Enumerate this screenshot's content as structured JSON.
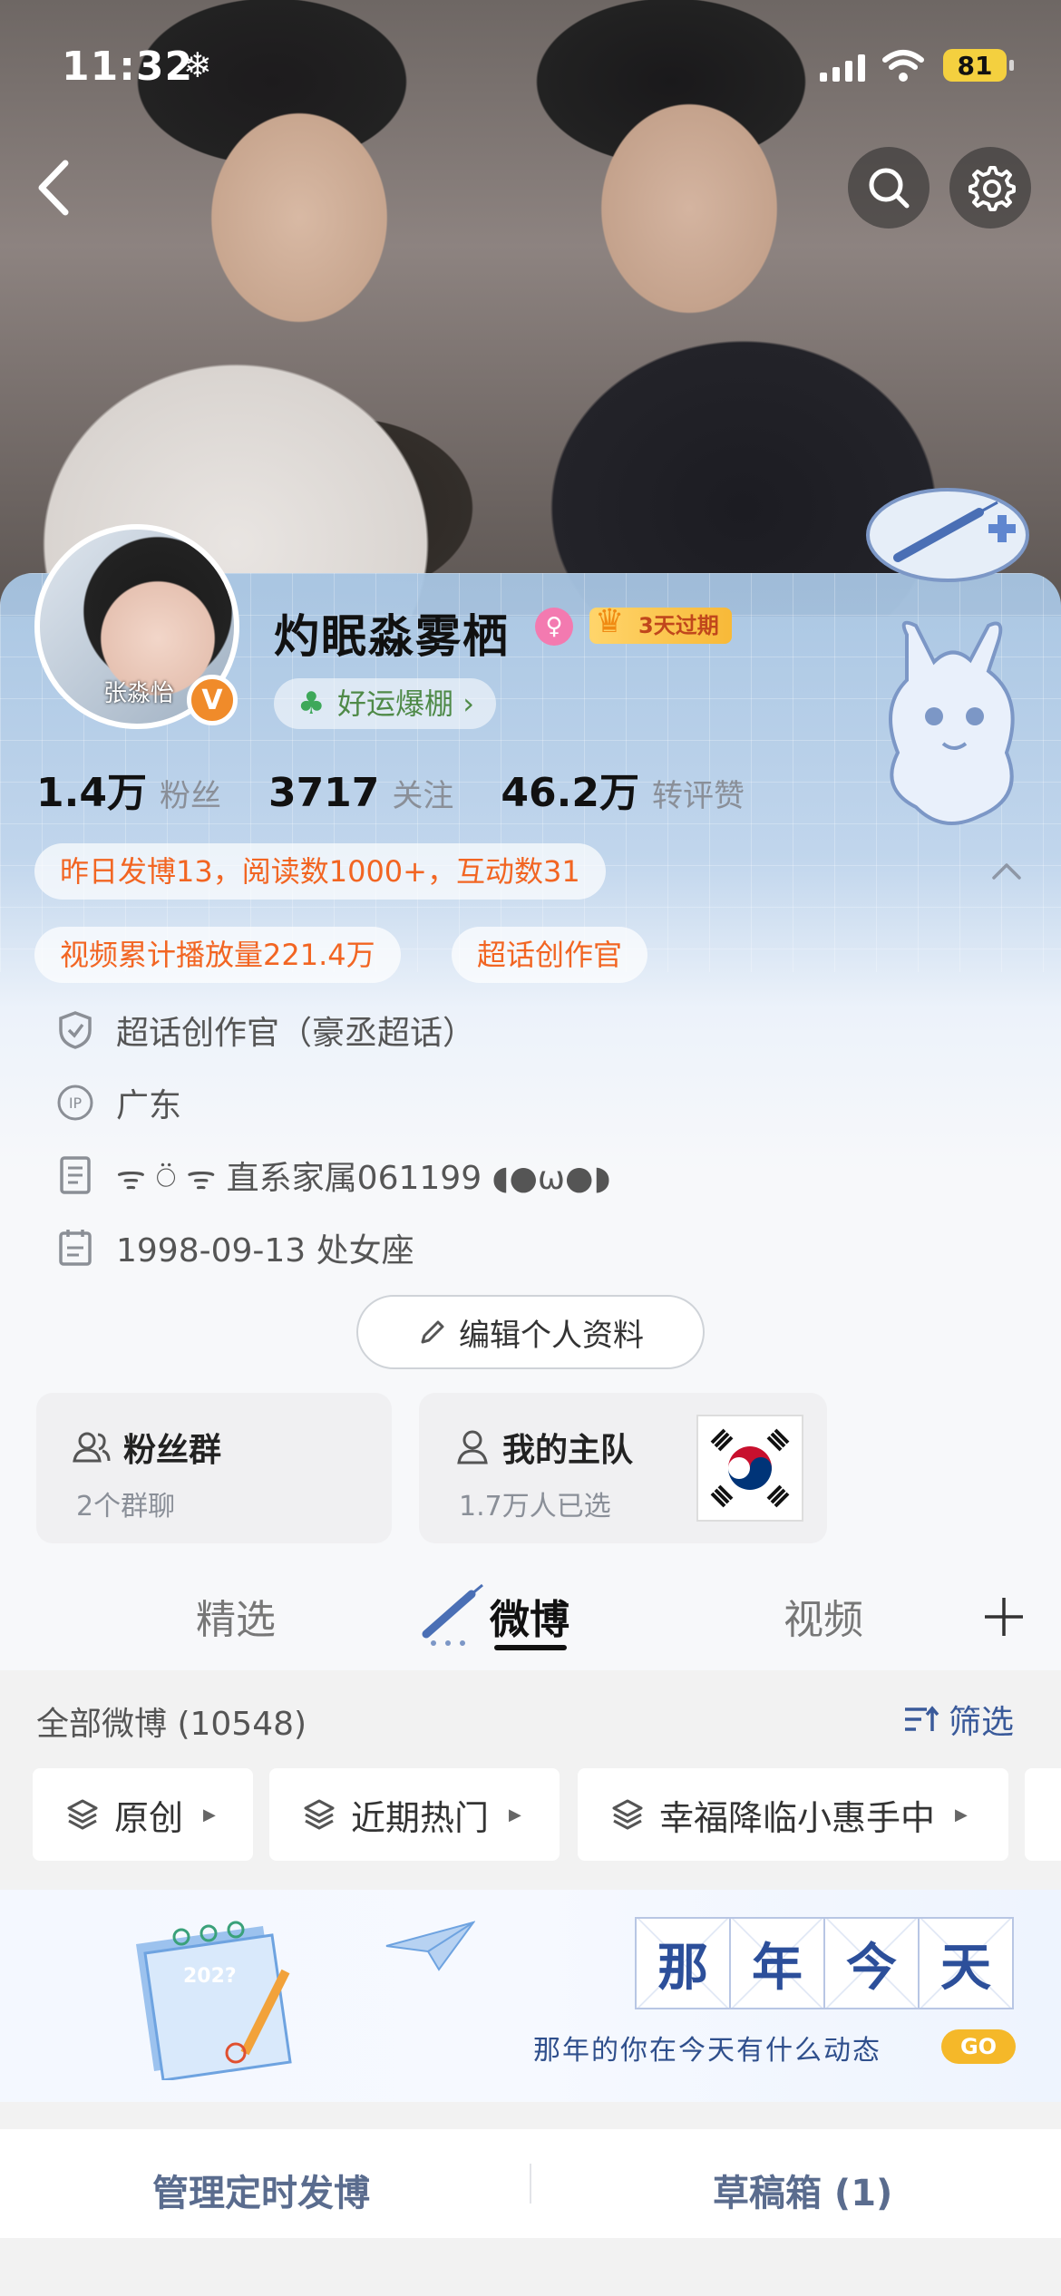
{
  "status_bar": {
    "time": "11:32",
    "time_icon": "snowflake",
    "battery": "81"
  },
  "header": {
    "back_icon": "chevron-left-icon",
    "search_icon": "search-icon",
    "settings_icon": "gear-icon"
  },
  "profile": {
    "username": "灼眠淼雾栖",
    "avatar_text": "张淼怡",
    "verified_badge": "V",
    "gender_icon": "female-icon",
    "vip_label": "3天过期",
    "luck_chip": "好运爆棚",
    "stats": [
      {
        "value": "1.4万",
        "label": "粉丝"
      },
      {
        "value": "3717",
        "label": "关注"
      },
      {
        "value": "46.2万",
        "label": "转评赞"
      }
    ],
    "yesterday_summary": "昨日发博13，阅读数1000+，互动数31",
    "video_plays": "视频累计播放量221.4万",
    "super_topic_chip": "超话创作官",
    "info": {
      "super_topic": "超话创作官（豪丞超话）",
      "ip": "广东",
      "bio": "ᯤ  ⍥  ᯤ 直系家属061199 ◖●ω●◗",
      "birthday": "1998-09-13 处女座"
    },
    "edit_button": "编辑个人资料"
  },
  "cards": {
    "fans_group": {
      "title": "粉丝群",
      "sub": "2个群聊"
    },
    "my_team": {
      "title": "我的主队",
      "sub": "1.7万人已选"
    }
  },
  "tabs": {
    "featured": "精选",
    "weibo": "微博",
    "video": "视频"
  },
  "list": {
    "title": "全部微博 (10548)",
    "filter": "筛选",
    "pills": [
      "原创",
      "近期热门",
      "幸福降临小惠手中"
    ]
  },
  "banner": {
    "calendar_year": "202?",
    "title_chars": [
      "那",
      "年",
      "今",
      "天"
    ],
    "subtitle": "那年的你在今天有什么动态",
    "go": "GO"
  },
  "bottom_bar": {
    "scheduled": "管理定时发博",
    "drafts": "草稿箱 (1)"
  }
}
